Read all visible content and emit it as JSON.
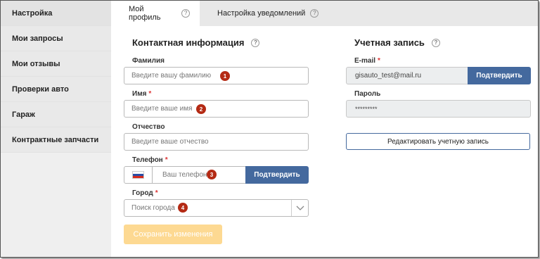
{
  "sidebar": {
    "items": [
      {
        "label": "Настройка"
      },
      {
        "label": "Мои запросы"
      },
      {
        "label": "Мои отзывы"
      },
      {
        "label": "Проверки авто"
      },
      {
        "label": "Гараж"
      },
      {
        "label": "Контрактные запчасти"
      }
    ]
  },
  "tabs": [
    {
      "label": "Мой профиль",
      "help": "?"
    },
    {
      "label": "Настройка уведомлений",
      "help": "?"
    }
  ],
  "contact": {
    "title": "Контактная информация",
    "help": "?",
    "surname_label": "Фамилия",
    "surname_placeholder": "Введите вашу фамилию",
    "surname_badge": "1",
    "name_label": "Имя",
    "name_required": "*",
    "name_placeholder": "Введите ваше имя",
    "name_badge": "2",
    "patronymic_label": "Отчество",
    "patronymic_placeholder": "Введите ваше отчество",
    "phone_label": "Телефон",
    "phone_required": "*",
    "phone_placeholder": "Ваш телефон",
    "phone_badge": "3",
    "phone_confirm": "Подтвердить",
    "city_label": "Город",
    "city_required": "*",
    "city_placeholder": "Поиск города",
    "city_badge": "4",
    "save_button": "Сохранить изменения"
  },
  "account": {
    "title": "Учетная запись",
    "help": "?",
    "email_label": "E-mail",
    "email_required": "*",
    "email_value": "gisauto_test@mail.ru",
    "email_confirm": "Подтвердить",
    "password_label": "Пароль",
    "password_value": "*********",
    "edit_button": "Редактировать учетную запись"
  },
  "colors": {
    "accent": "#44699e",
    "badge": "#b42a14",
    "save_button": "#fdd992",
    "required": "#dd3333"
  }
}
